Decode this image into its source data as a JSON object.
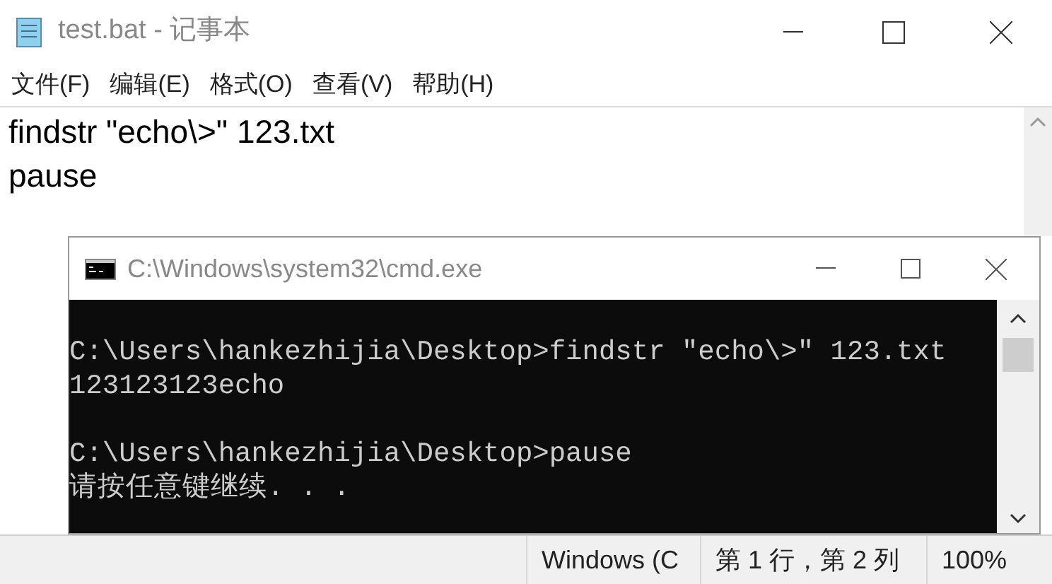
{
  "notepad": {
    "title": "test.bat - 记事本",
    "menu": [
      "文件(F)",
      "编辑(E)",
      "格式(O)",
      "查看(V)",
      "帮助(H)"
    ],
    "lines": [
      "findstr \"echo\\>\" 123.txt",
      "pause"
    ],
    "status_bar": [
      "Windows (C",
      "第 1 行，第 2 列",
      "100%"
    ]
  },
  "cmd": {
    "title": "C:\\Windows\\system32\\cmd.exe",
    "blocks": [
      [
        "C:\\Users\\hankezhijia\\Desktop>findstr \"echo\\>\" 123.txt",
        "123123123echo"
      ],
      [
        "C:\\Users\\hankezhijia\\Desktop>pause",
        "请按任意键继续. . ."
      ]
    ]
  }
}
